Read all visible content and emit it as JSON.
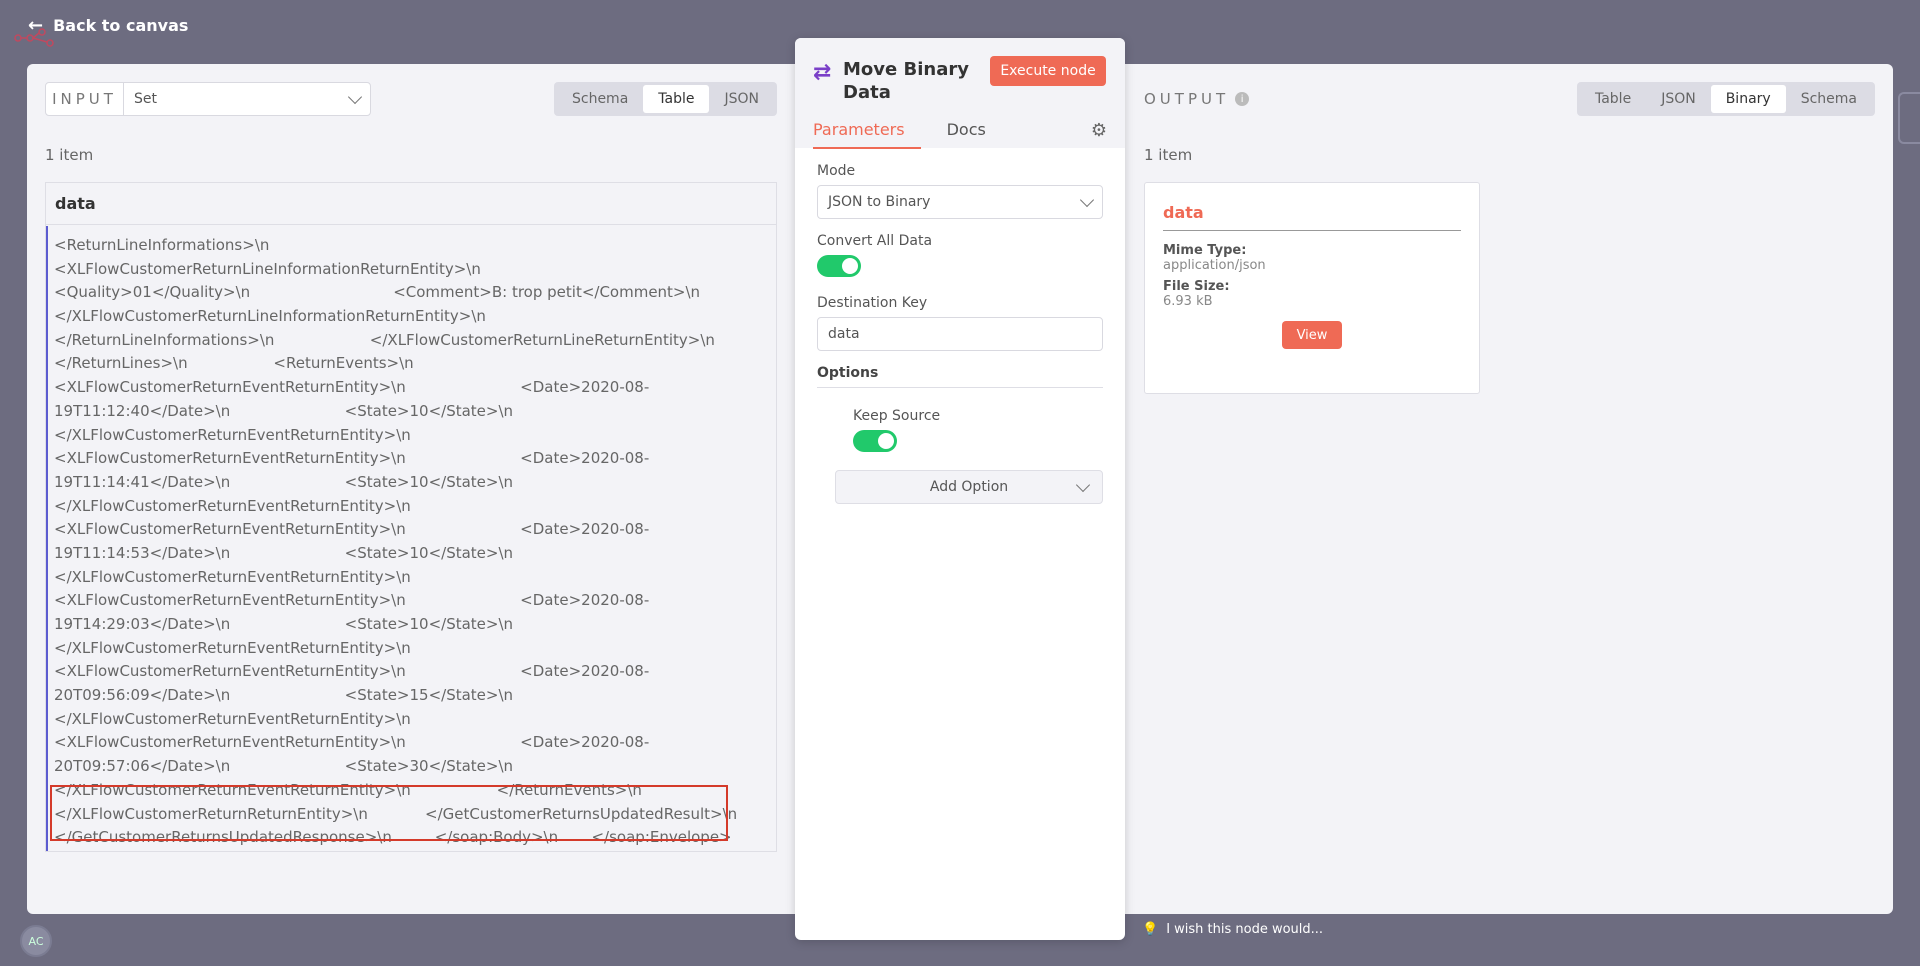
{
  "header": {
    "back_label": "Back to canvas",
    "avatar_initials": "AC"
  },
  "input": {
    "label": "INPUT",
    "source_node": "Set",
    "view_modes": [
      "Schema",
      "Table",
      "JSON"
    ],
    "active_view": "Table",
    "item_count": "1 item",
    "column_header": "data",
    "lines": [
      "<ReturnLineInformations>\\n",
      "<XLFlowCustomerReturnLineInformationReturnEntity>\\n",
      "<Quality>01</Quality>\\n                              <Comment>B: trop petit</Comment>\\n",
      "</XLFlowCustomerReturnLineInformationReturnEntity>\\n",
      "</ReturnLineInformations>\\n                    </XLFlowCustomerReturnLineReturnEntity>\\n",
      "</ReturnLines>\\n                  <ReturnEvents>\\n",
      "<XLFlowCustomerReturnEventReturnEntity>\\n                        <Date>2020-08-",
      "19T11:12:40</Date>\\n                        <State>10</State>\\n",
      "</XLFlowCustomerReturnEventReturnEntity>\\n",
      "<XLFlowCustomerReturnEventReturnEntity>\\n                        <Date>2020-08-",
      "19T11:14:41</Date>\\n                        <State>10</State>\\n",
      "</XLFlowCustomerReturnEventReturnEntity>\\n",
      "<XLFlowCustomerReturnEventReturnEntity>\\n                        <Date>2020-08-",
      "19T11:14:53</Date>\\n                        <State>10</State>\\n",
      "</XLFlowCustomerReturnEventReturnEntity>\\n",
      "<XLFlowCustomerReturnEventReturnEntity>\\n                        <Date>2020-08-",
      "19T14:29:03</Date>\\n                        <State>10</State>\\n",
      "</XLFlowCustomerReturnEventReturnEntity>\\n",
      "<XLFlowCustomerReturnEventReturnEntity>\\n                        <Date>2020-08-",
      "20T09:56:09</Date>\\n                        <State>15</State>\\n",
      "</XLFlowCustomerReturnEventReturnEntity>\\n",
      "<XLFlowCustomerReturnEventReturnEntity>\\n                        <Date>2020-08-",
      "20T09:57:06</Date>\\n                        <State>30</State>\\n",
      "</XLFlowCustomerReturnEventReturnEntity>\\n                  </ReturnEvents>\\n",
      "</XLFlowCustomerReturnReturnEntity>\\n            </GetCustomerReturnsUpdatedResult>\\n",
      "</GetCustomerReturnsUpdatedResponse>\\n         </soap:Body>\\n       </soap:Envelope>"
    ]
  },
  "node": {
    "title": "Move Binary Data",
    "execute_label": "Execute node",
    "tabs": [
      "Parameters",
      "Docs"
    ],
    "active_tab": "Parameters",
    "mode_label": "Mode",
    "mode_value": "JSON to Binary",
    "convert_all_label": "Convert All Data",
    "convert_all_on": true,
    "destination_key_label": "Destination Key",
    "destination_key_value": "data",
    "options_label": "Options",
    "keep_source_label": "Keep Source",
    "keep_source_on": true,
    "add_option_label": "Add Option"
  },
  "output": {
    "label": "OUTPUT",
    "view_modes": [
      "Table",
      "JSON",
      "Binary",
      "Schema"
    ],
    "active_view": "Binary",
    "item_count": "1 item",
    "binary": {
      "title": "data",
      "mime_type_label": "Mime Type:",
      "mime_type_value": "application/json",
      "file_size_label": "File Size:",
      "file_size_value": "6.93 kB",
      "view_label": "View"
    }
  },
  "footer": {
    "wish_text": "I wish this node would..."
  },
  "colors": {
    "accent": "#ef6a55",
    "toggle_on": "#21c96b",
    "highlight_border": "#d43a2a",
    "cell_border": "#5b5bd0",
    "node_icon": "#7a3fc8"
  }
}
